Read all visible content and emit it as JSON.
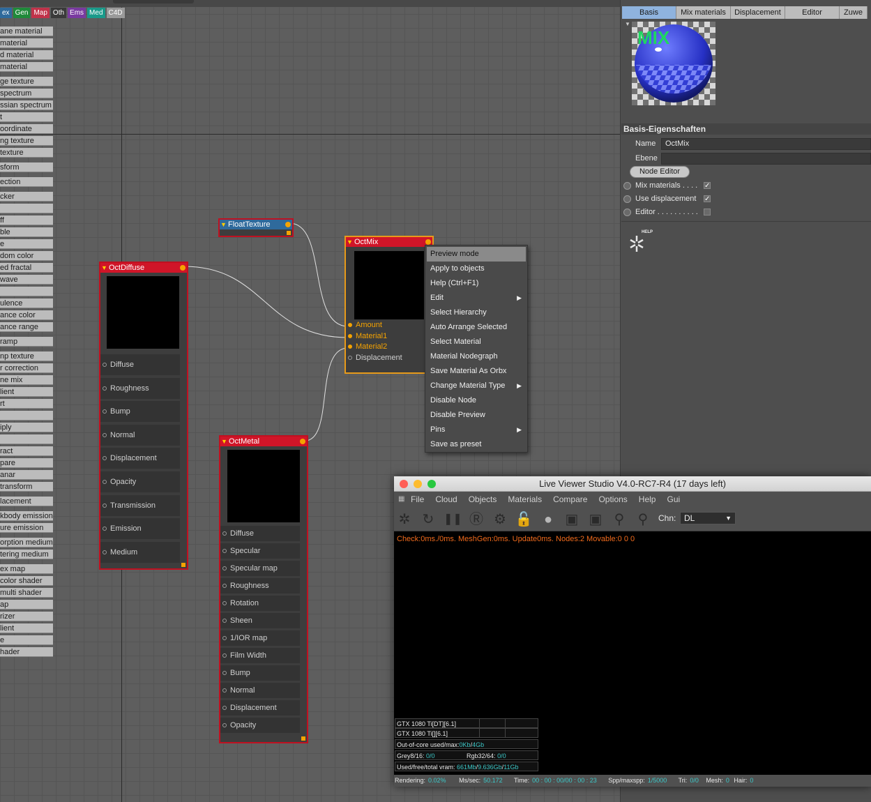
{
  "category_tabs": [
    {
      "label": "ex",
      "color": "#2f6a9c"
    },
    {
      "label": "Gen",
      "color": "#1f8a3a"
    },
    {
      "label": "Map",
      "color": "#c0334a"
    },
    {
      "label": "Oth",
      "color": "#3a3a3a"
    },
    {
      "label": "Ems",
      "color": "#7a3aa0"
    },
    {
      "label": "Med",
      "color": "#1a9a8a"
    },
    {
      "label": "C4D",
      "color": "#9a9a9a"
    }
  ],
  "node_list": [
    "ane material",
    "material",
    "d material",
    "material",
    "ge texture",
    "spectrum",
    "ssian spectrum",
    "t",
    "oordinate",
    "ng texture",
    "texture",
    "sform",
    "ection",
    "cker",
    "",
    "ff",
    "ble",
    "e",
    "dom color",
    "ed fractal",
    "wave",
    "",
    "ulence",
    "ance color",
    "ance range",
    "ramp",
    "np texture",
    "r correction",
    "ne mix",
    "lient",
    "rt",
    "",
    "iply",
    "",
    "ract",
    "pare",
    "anar",
    "transform",
    "lacement",
    "kbody emission",
    "ure emission",
    "orption medium",
    "tering medium",
    "ex map",
    "color shader",
    "multi shader",
    "ap",
    "rizer",
    "lient",
    "e",
    "hader"
  ],
  "nodes": {
    "float_texture": {
      "title": "FloatTexture"
    },
    "oct_mix": {
      "title": "OctMix",
      "ports": [
        {
          "label": "Amount",
          "active": true
        },
        {
          "label": "Material1",
          "active": true
        },
        {
          "label": "Material2",
          "active": true
        },
        {
          "label": "Displacement",
          "active": false
        }
      ]
    },
    "oct_diffuse": {
      "title": "OctDiffuse",
      "ports": [
        "Diffuse",
        "Roughness",
        "Bump",
        "Normal",
        "Displacement",
        "Opacity",
        "Transmission",
        "Emission",
        "Medium"
      ]
    },
    "oct_metal": {
      "title": "OctMetal",
      "ports": [
        "Diffuse",
        "Specular",
        "Specular map",
        "Roughness",
        "Rotation",
        "Sheen",
        "1/IOR map",
        "Film Width",
        "Bump",
        "Normal",
        "Displacement",
        "Opacity"
      ]
    }
  },
  "context_menu": [
    {
      "label": "Preview mode",
      "highlighted": true,
      "submenu": false
    },
    {
      "label": "Apply to objects",
      "submenu": false
    },
    {
      "label": "Help (Ctrl+F1)",
      "submenu": false
    },
    {
      "label": "Edit",
      "submenu": true
    },
    {
      "label": "Select Hierarchy",
      "submenu": false
    },
    {
      "label": "Auto Arrange Selected",
      "submenu": false
    },
    {
      "label": "Select Material",
      "submenu": false
    },
    {
      "label": "Material Nodegraph",
      "submenu": false
    },
    {
      "label": "Save Material As Orbx",
      "submenu": false
    },
    {
      "label": "Change Material Type",
      "submenu": true
    },
    {
      "label": "Disable Node",
      "submenu": false
    },
    {
      "label": "Disable Preview",
      "submenu": false
    },
    {
      "label": "Pins",
      "submenu": true
    },
    {
      "label": "Save as preset",
      "submenu": false
    }
  ],
  "attributes": {
    "tabs": [
      "Basis",
      "Mix materials",
      "Displacement",
      "Editor",
      "Zuwe"
    ],
    "active_tab": "Basis",
    "thumbnail_label": "MIX",
    "section_title": "Basis-Eigenschaften",
    "name_label": "Name",
    "name_value": "OctMix",
    "layer_label": "Ebene",
    "layer_value": "",
    "node_editor_button": "Node Editor",
    "options": [
      {
        "label": "Mix materials . . . .",
        "checked": true
      },
      {
        "label": "Use displacement",
        "checked": true
      },
      {
        "label": "Editor . . . . . . . . . .",
        "checked": false
      }
    ],
    "help_label": "HELP"
  },
  "live_viewer": {
    "title": "Live Viewer Studio V4.0-RC7-R4 (17 days left)",
    "menu": [
      "File",
      "Cloud",
      "Objects",
      "Materials",
      "Compare",
      "Options",
      "Help",
      "Gui"
    ],
    "toolbar_icons": [
      "octane-logo-icon",
      "refresh-icon",
      "pause-icon",
      "r-icon",
      "gear-icon",
      "lock-icon",
      "material-ball-icon",
      "region-icon",
      "film-region-icon",
      "focus-pin-icon",
      "material-pin-icon"
    ],
    "channel_label": "Chn:",
    "channel_value": "DL",
    "status_line": "Check:0ms./0ms. MeshGen:0ms. Update0ms. Nodes:2 Movable:0  0 0",
    "gpus": [
      "GTX 1080 Ti[DT][6.1]",
      "GTX 1080 Ti[][6.1]"
    ],
    "out_of_core_label": "Out-of-core used/max:",
    "out_of_core_used": "0Kb",
    "out_of_core_max": "4Gb",
    "grey_label": "Grey8/16:",
    "grey_value": "0/0",
    "rgb_label": "Rgb32/64:",
    "rgb_value": "0/0",
    "vram_label": "Used/free/total vram:",
    "vram_used": "661Mb",
    "vram_free": "9.636Gb",
    "vram_total": "11Gb",
    "statusbar": {
      "rendering_label": "Rendering:",
      "rendering_value": "0.02%",
      "mssec_label": "Ms/sec:",
      "mssec_value": "50.172",
      "time_label": "Time:",
      "time_value": "00 : 00 : 00/00 : 00 : 23",
      "spp_label": "Spp/maxspp:",
      "spp_value": "1/5000",
      "tri_label": "Tri:",
      "tri_value": "0/0",
      "mesh_label": "Mesh:",
      "mesh_value": "0",
      "hair_label": "Hair:",
      "hair_value": "0"
    }
  },
  "colors": {
    "node_border": "#c01020",
    "selected_border": "#e79a1a",
    "port_active": "#f5a300",
    "status_text": "#f26b1c",
    "stat_value": "#3cc8c8",
    "tab_active": "#8fb3de"
  }
}
